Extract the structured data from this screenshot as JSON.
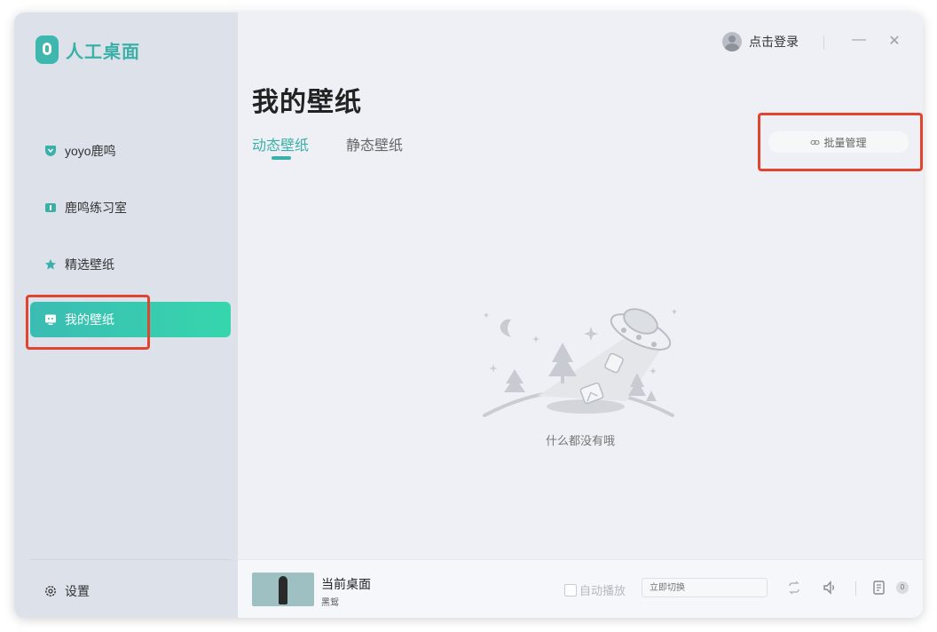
{
  "app": {
    "logo_text": "人工桌面",
    "accent_color": "#3ab0a8"
  },
  "sidebar": {
    "items": [
      {
        "label": "yoyo鹿鸣",
        "icon": "heart-shield-icon"
      },
      {
        "label": "鹿鸣练习室",
        "icon": "practice-room-icon"
      },
      {
        "label": "精选壁纸",
        "icon": "star-icon"
      },
      {
        "label": "我的壁纸",
        "icon": "monitor-icon",
        "active": true
      }
    ],
    "settings_label": "设置"
  },
  "topbar": {
    "login_label": "点击登录",
    "minimize": "—",
    "close": "✕"
  },
  "main": {
    "title": "我的壁纸",
    "tabs": [
      {
        "label": "动态壁纸",
        "active": true
      },
      {
        "label": "静态壁纸",
        "active": false
      }
    ],
    "batch_manage_label": "批量管理",
    "empty_text": "什么都没有哦"
  },
  "player": {
    "current_title": "当前桌面",
    "current_sub": "黑鸳",
    "autoplay_label": "自动播放",
    "switch_placeholder": "立即切换",
    "playlist_count": "0"
  }
}
